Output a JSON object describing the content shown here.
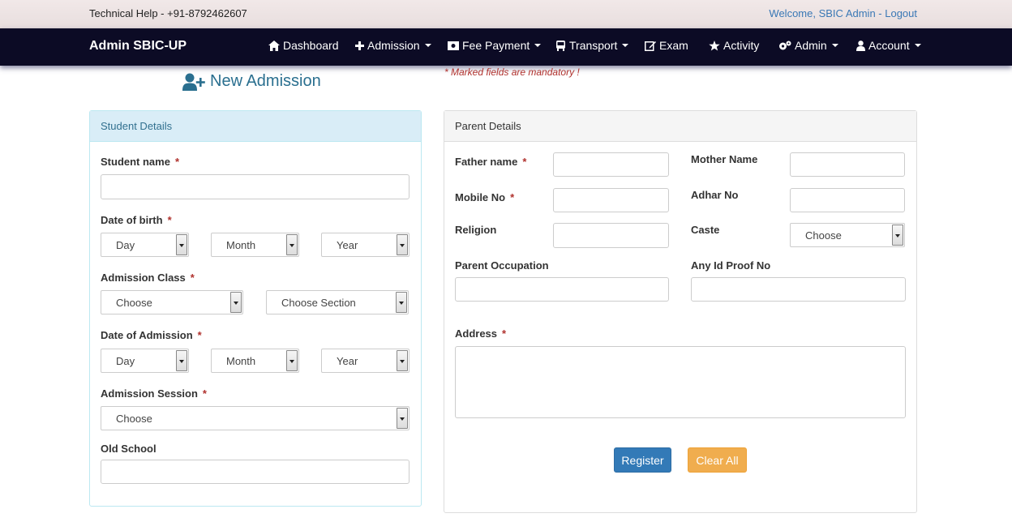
{
  "topbar": {
    "help": "Technical Help - +91-8792462607",
    "welcome_prefix": "Welcome, SBIC Admin - ",
    "logout": "Logout"
  },
  "navbar": {
    "brand": "Admin SBIC-UP",
    "items": [
      {
        "label": "Dashboard",
        "icon": "home-icon"
      },
      {
        "label": "Admission",
        "icon": "plus-icon",
        "dropdown": true
      },
      {
        "label": "Fee Payment",
        "icon": "money-icon",
        "dropdown": true
      },
      {
        "label": "Transport",
        "icon": "bus-icon",
        "dropdown": true
      },
      {
        "label": "Exam",
        "icon": "edit-icon"
      },
      {
        "label": "Activity",
        "icon": "star-icon"
      },
      {
        "label": "Admin",
        "icon": "cogs-icon",
        "dropdown": true
      },
      {
        "label": "Account",
        "icon": "user-icon",
        "dropdown": true
      }
    ]
  },
  "page": {
    "title": "New Admission",
    "mandatory_note": "* Marked fields are mandatory !"
  },
  "student": {
    "heading": "Student Details",
    "name_label": "Student name",
    "dob_label": "Date of birth",
    "dob_day": "Day",
    "dob_month": "Month",
    "dob_year": "Year",
    "class_label": "Admission Class",
    "class_value": "Choose",
    "section_value": "Choose Section",
    "doa_label": "Date of Admission",
    "doa_day": "Day",
    "doa_month": "Month",
    "doa_year": "Year",
    "session_label": "Admission Session",
    "session_value": "Choose",
    "old_school_label": "Old School"
  },
  "parent": {
    "heading": "Parent Details",
    "father_label": "Father name",
    "mother_label": "Mother Name",
    "mobile_label": "Mobile No",
    "adhar_label": "Adhar No",
    "religion_label": "Religion",
    "caste_label": "Caste",
    "caste_value": "Choose",
    "occupation_label": "Parent Occupation",
    "idproof_label": "Any Id Proof No",
    "address_label": "Address",
    "required_mark": "*"
  },
  "actions": {
    "register": "Register",
    "clear": "Clear All"
  },
  "colors": {
    "navbar": "#0c0b25",
    "primary": "#337ab7",
    "warning": "#f0ad4e",
    "required": "#b0312d"
  }
}
